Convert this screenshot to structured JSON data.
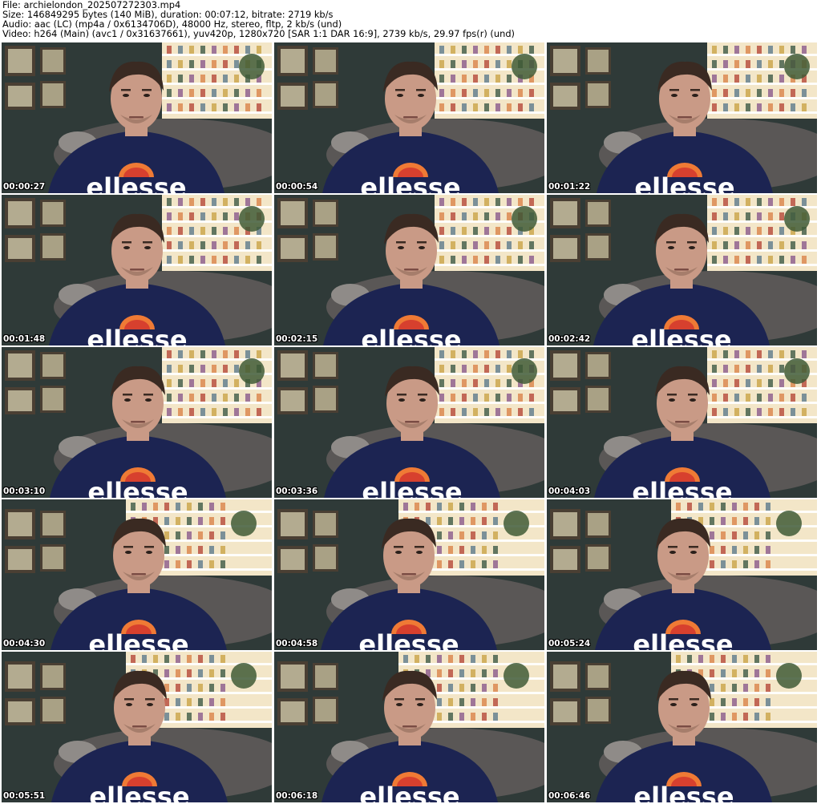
{
  "header": {
    "file_line": "File: archielondon_202507272303.mp4",
    "size_line": "Size: 146849295 bytes (140 MiB), duration: 00:07:12, bitrate: 2719 kb/s",
    "audio_line": "Audio: aac (LC) (mp4a / 0x6134706D), 48000 Hz, stereo, fltp, 2 kb/s (und)",
    "video_line": "Video: h264 (Main) (avc1 / 0x31637661), yuv420p, 1280x720 [SAR 1:1 DAR 16:9], 2739 kb/s, 29.97 fps(r) (und)"
  },
  "thumbnails": [
    {
      "timestamp": "00:00:27"
    },
    {
      "timestamp": "00:00:54"
    },
    {
      "timestamp": "00:01:22"
    },
    {
      "timestamp": "00:01:48"
    },
    {
      "timestamp": "00:02:15"
    },
    {
      "timestamp": "00:02:42"
    },
    {
      "timestamp": "00:03:10"
    },
    {
      "timestamp": "00:03:36"
    },
    {
      "timestamp": "00:04:03"
    },
    {
      "timestamp": "00:04:30"
    },
    {
      "timestamp": "00:04:58"
    },
    {
      "timestamp": "00:05:24"
    },
    {
      "timestamp": "00:05:51"
    },
    {
      "timestamp": "00:06:18"
    },
    {
      "timestamp": "00:06:46"
    }
  ],
  "shirt_brand_text": "ellesse",
  "colors": {
    "wall": "#2f3a38",
    "shelf_light": "#f3e6c8",
    "shirt": "#1c2452",
    "logo_red": "#d7402e",
    "logo_orange": "#ef7a35",
    "skin": "#c99a86",
    "hair": "#3a2a22",
    "sofa": "#5a5756",
    "frame": "#4a3f33"
  }
}
